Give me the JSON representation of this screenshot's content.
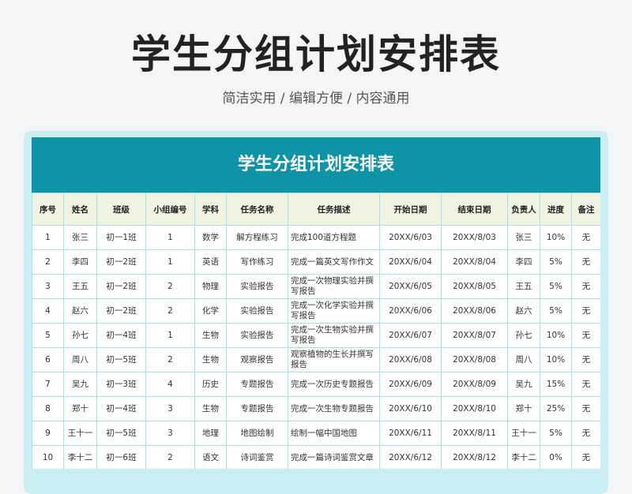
{
  "page": {
    "title": "学生分组计划安排表",
    "subtitle": "简洁实用 / 编辑方便 / 内容通用"
  },
  "sheet": {
    "title": "学生分组计划安排表",
    "headers": [
      "序号",
      "姓名",
      "班级",
      "小组编号",
      "学科",
      "任务名称",
      "任务描述",
      "开始日期",
      "结束日期",
      "负责人",
      "进度",
      "备注"
    ],
    "rows": [
      [
        "1",
        "张三",
        "初一1班",
        "1",
        "数学",
        "解方程练习",
        "完成100道方程题",
        "20XX/6/03",
        "20XX/8/03",
        "张三",
        "10%",
        "无"
      ],
      [
        "2",
        "李四",
        "初一2班",
        "1",
        "英语",
        "写作练习",
        "完成一篇英文写作作文",
        "20XX/6/04",
        "20XX/8/04",
        "李四",
        "5%",
        "无"
      ],
      [
        "3",
        "王五",
        "初一2班",
        "2",
        "物理",
        "实验报告",
        "完成一次物理实验并撰写报告",
        "20XX/6/05",
        "20XX/8/05",
        "王五",
        "5%",
        "无"
      ],
      [
        "4",
        "赵六",
        "初一2班",
        "2",
        "化学",
        "实验报告",
        "完成一次化学实验并撰写报告",
        "20XX/6/06",
        "20XX/8/06",
        "赵六",
        "5%",
        "无"
      ],
      [
        "5",
        "孙七",
        "初一4班",
        "1",
        "生物",
        "实验报告",
        "完成一次生物实验并撰写报告",
        "20XX/6/07",
        "20XX/8/07",
        "孙七",
        "10%",
        "无"
      ],
      [
        "6",
        "周八",
        "初一5班",
        "2",
        "生物",
        "观察报告",
        "观察植物的生长并撰写报告",
        "20XX/6/08",
        "20XX/8/08",
        "周八",
        "10%",
        "无"
      ],
      [
        "7",
        "吴九",
        "初一3班",
        "4",
        "历史",
        "专题报告",
        "完成一次历史专题报告",
        "20XX/6/09",
        "20XX/8/09",
        "吴九",
        "15%",
        "无"
      ],
      [
        "8",
        "郑十",
        "初一4班",
        "3",
        "生物",
        "专题报告",
        "完成一次生物专题报告",
        "20XX/6/10",
        "20XX/8/10",
        "郑十",
        "25%",
        "无"
      ],
      [
        "9",
        "王十一",
        "初一5班",
        "3",
        "地理",
        "地图绘制",
        "绘制一幅中国地图",
        "20XX/6/11",
        "20XX/8/11",
        "王十一",
        "5%",
        "无"
      ],
      [
        "10",
        "李十二",
        "初一6班",
        "2",
        "语文",
        "诗词鉴赏",
        "完成一篇诗词鉴赏文章",
        "20XX/6/12",
        "20XX/8/12",
        "李十二",
        "0%",
        "无"
      ]
    ]
  }
}
